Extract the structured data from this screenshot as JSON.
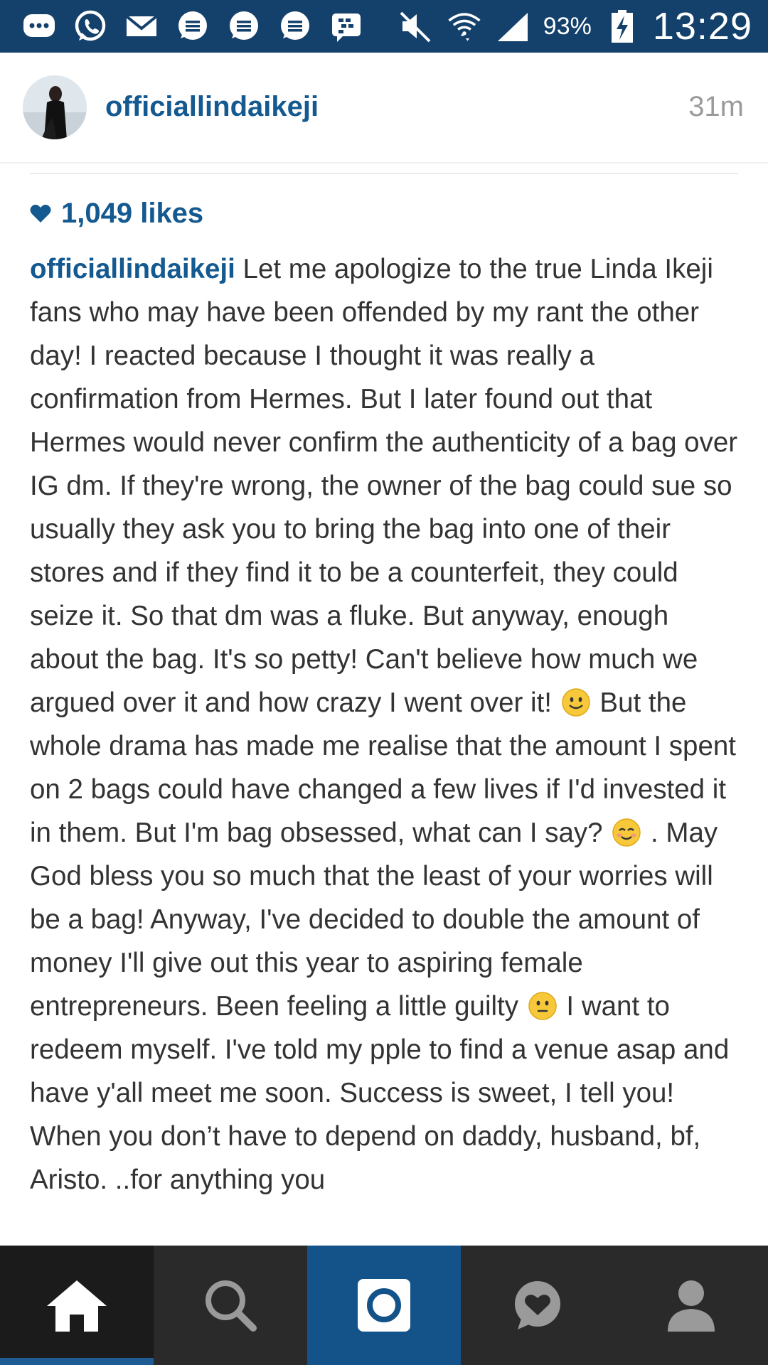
{
  "status_bar": {
    "notification_icons": [
      "chat-bubble-icon",
      "whatsapp-icon",
      "mail-icon",
      "message-icon",
      "message-icon",
      "message-icon",
      "bbm-icon"
    ],
    "battery_percent": "93%",
    "time": "13:29"
  },
  "post": {
    "username": "officiallindaikeji",
    "time_ago": "31m",
    "likes": "1,049 likes",
    "caption_user": "officiallindaikeji",
    "caption_parts": [
      "Let me apologize to the true Linda Ikeji fans who may have been offended by my rant the other day! I reacted because I thought it was really a confirmation from Hermes. But I later found out that Hermes would never confirm the authenticity of a bag over IG dm. If they're wrong, the owner of the bag could sue so usually they ask you to bring the bag into one of their stores and if they find it to be a counterfeit, they could seize it. So that dm was a fluke. But anyway, enough about the bag. It's so petty! Can't believe how much we argued over it and how crazy I went over it!",
      "But the whole drama has made me realise that the amount I spent on 2 bags could have changed a few lives if I'd invested it in them. But I'm bag obsessed, what can I say?",
      ". May God bless you so much that the least of your worries will be a bag! Anyway, I've decided to double the amount of money I'll give out this year to aspiring female entrepreneurs. Been feeling a little guilty",
      "I want to redeem myself. I've told my pple to find a venue asap and have y'all meet me soon. Success is sweet, I tell you! When you don’t have to depend on daddy, husband, bf, Aristo. ..for anything you"
    ]
  },
  "nav": {
    "items": [
      "home-icon",
      "search-icon",
      "camera-icon",
      "activity-icon",
      "profile-icon"
    ],
    "active": "home-icon"
  },
  "colors": {
    "status_bar": "#14416b",
    "link_blue": "#14598f",
    "nav_bg": "#2a2a2a",
    "nav_camera": "#14538a"
  }
}
